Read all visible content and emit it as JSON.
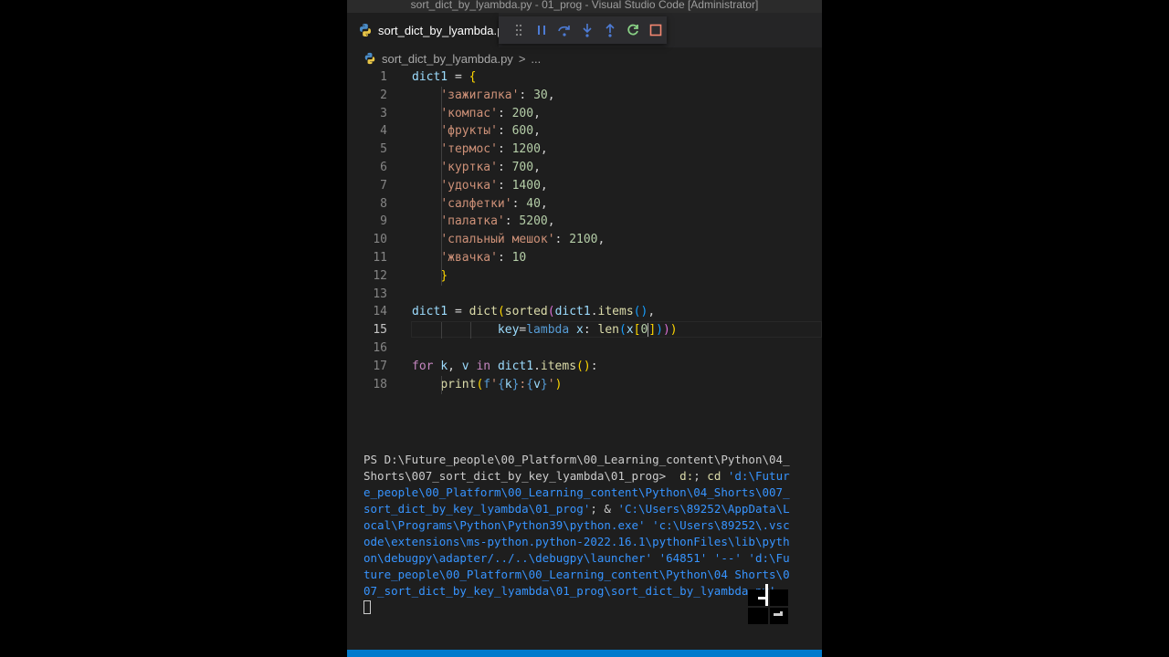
{
  "window": {
    "title": "sort_dict_by_lyambda.py - 01_prog - Visual Studio Code [Administrator]"
  },
  "tab": {
    "label": "sort_dict_by_lyambda.py",
    "icon": "python-icon"
  },
  "debug_toolbar": {
    "buttons": [
      {
        "name": "drag-handle-icon",
        "color": "#8b8b8b"
      },
      {
        "name": "pause-icon",
        "color": "#4d7bd4"
      },
      {
        "name": "step-over-icon",
        "color": "#4d7bd4"
      },
      {
        "name": "step-into-icon",
        "color": "#4d7bd4"
      },
      {
        "name": "step-out-icon",
        "color": "#4d7bd4"
      },
      {
        "name": "restart-icon",
        "color": "#89d185"
      },
      {
        "name": "stop-icon",
        "color": "#f48771"
      }
    ]
  },
  "breadcrumb": {
    "file": "sort_dict_by_lyambda.py",
    "separator": ">",
    "more": "..."
  },
  "editor": {
    "active_line": 15,
    "line_numbers": [
      "1",
      "2",
      "3",
      "4",
      "5",
      "6",
      "7",
      "8",
      "9",
      "10",
      "11",
      "12",
      "13",
      "14",
      "15",
      "16",
      "17",
      "18"
    ],
    "lines": [
      {
        "tokens": [
          [
            "v",
            "dict1"
          ],
          [
            "t",
            " = "
          ],
          [
            "y",
            "{"
          ]
        ]
      },
      {
        "tokens": [
          [
            "t",
            "    "
          ],
          [
            "s",
            "'зажигалка'"
          ],
          [
            "t",
            ": "
          ],
          [
            "n",
            "30"
          ],
          [
            "t",
            ","
          ]
        ]
      },
      {
        "tokens": [
          [
            "t",
            "    "
          ],
          [
            "s",
            "'компас'"
          ],
          [
            "t",
            ": "
          ],
          [
            "n",
            "200"
          ],
          [
            "t",
            ","
          ]
        ]
      },
      {
        "tokens": [
          [
            "t",
            "    "
          ],
          [
            "s",
            "'фрукты'"
          ],
          [
            "t",
            ": "
          ],
          [
            "n",
            "600"
          ],
          [
            "t",
            ","
          ]
        ]
      },
      {
        "tokens": [
          [
            "t",
            "    "
          ],
          [
            "s",
            "'термос'"
          ],
          [
            "t",
            ": "
          ],
          [
            "n",
            "1200"
          ],
          [
            "t",
            ","
          ]
        ]
      },
      {
        "tokens": [
          [
            "t",
            "    "
          ],
          [
            "s",
            "'куртка'"
          ],
          [
            "t",
            ": "
          ],
          [
            "n",
            "700"
          ],
          [
            "t",
            ","
          ]
        ]
      },
      {
        "tokens": [
          [
            "t",
            "    "
          ],
          [
            "s",
            "'удочка'"
          ],
          [
            "t",
            ": "
          ],
          [
            "n",
            "1400"
          ],
          [
            "t",
            ","
          ]
        ]
      },
      {
        "tokens": [
          [
            "t",
            "    "
          ],
          [
            "s",
            "'салфетки'"
          ],
          [
            "t",
            ": "
          ],
          [
            "n",
            "40"
          ],
          [
            "t",
            ","
          ]
        ]
      },
      {
        "tokens": [
          [
            "t",
            "    "
          ],
          [
            "s",
            "'палатка'"
          ],
          [
            "t",
            ": "
          ],
          [
            "n",
            "5200"
          ],
          [
            "t",
            ","
          ]
        ]
      },
      {
        "tokens": [
          [
            "t",
            "    "
          ],
          [
            "s",
            "'спальный мешок'"
          ],
          [
            "t",
            ": "
          ],
          [
            "n",
            "2100"
          ],
          [
            "t",
            ","
          ]
        ]
      },
      {
        "tokens": [
          [
            "t",
            "    "
          ],
          [
            "s",
            "'жвачка'"
          ],
          [
            "t",
            ": "
          ],
          [
            "n",
            "10"
          ]
        ]
      },
      {
        "tokens": [
          [
            "t",
            "    "
          ],
          [
            "y",
            "}"
          ]
        ]
      },
      {
        "tokens": []
      },
      {
        "tokens": [
          [
            "v",
            "dict1"
          ],
          [
            "t",
            " = "
          ],
          [
            "f",
            "dict"
          ],
          [
            "y",
            "("
          ],
          [
            "f",
            "sorted"
          ],
          [
            "p",
            "("
          ],
          [
            "v",
            "dict1"
          ],
          [
            "t",
            "."
          ],
          [
            "f",
            "items"
          ],
          [
            "b",
            "()"
          ],
          [
            "t",
            ","
          ]
        ]
      },
      {
        "tokens": [
          [
            "t",
            "            "
          ],
          [
            "v",
            "key"
          ],
          [
            "t",
            "="
          ],
          [
            "k",
            "lambda"
          ],
          [
            "t",
            " "
          ],
          [
            "v",
            "x"
          ],
          [
            "t",
            ": "
          ],
          [
            "f",
            "len"
          ],
          [
            "b",
            "("
          ],
          [
            "v",
            "x"
          ],
          [
            "y",
            "["
          ],
          [
            "n",
            "0"
          ],
          [
            "cursor",
            ""
          ],
          [
            "y",
            "]"
          ],
          [
            "b",
            ")"
          ],
          [
            "p",
            ")"
          ],
          [
            "y",
            ")"
          ]
        ]
      },
      {
        "tokens": []
      },
      {
        "tokens": [
          [
            "c",
            "for"
          ],
          [
            "t",
            " "
          ],
          [
            "v",
            "k"
          ],
          [
            "t",
            ", "
          ],
          [
            "v",
            "v"
          ],
          [
            "t",
            " "
          ],
          [
            "c",
            "in"
          ],
          [
            "t",
            " "
          ],
          [
            "v",
            "dict1"
          ],
          [
            "t",
            "."
          ],
          [
            "f",
            "items"
          ],
          [
            "y",
            "()"
          ],
          [
            "t",
            ":"
          ]
        ]
      },
      {
        "tokens": [
          [
            "t",
            "    "
          ],
          [
            "f",
            "print"
          ],
          [
            "y",
            "("
          ],
          [
            "k",
            "f"
          ],
          [
            "s",
            "'"
          ],
          [
            "k",
            "{"
          ],
          [
            "v",
            "k"
          ],
          [
            "k",
            "}"
          ],
          [
            "s",
            ":"
          ],
          [
            "k",
            "{"
          ],
          [
            "v",
            "v"
          ],
          [
            "k",
            "}"
          ],
          [
            "s",
            "'"
          ],
          [
            "y",
            ")"
          ]
        ]
      }
    ]
  },
  "terminal": {
    "lines": [
      [
        [
          "tprompt",
          "PS D:\\Future_people\\00_Platform\\00_Learning_content\\Python\\04_"
        ]
      ],
      [
        [
          "tprompt",
          "Shorts\\007_sort_dict_by_key_lyambda\\01_prog> "
        ],
        [
          "tcmd",
          " d:"
        ],
        [
          "tprompt",
          "; "
        ],
        [
          "tcmd",
          "cd"
        ],
        [
          "targ",
          " 'd:\\Futur"
        ]
      ],
      [
        [
          "targ",
          "e_people\\00_Platform\\00_Learning_content\\Python\\04_Shorts\\007_"
        ]
      ],
      [
        [
          "targ",
          "sort_dict_by_key_lyambda\\01_prog'"
        ],
        [
          "tprompt",
          "; & "
        ],
        [
          "targ",
          "'C:\\Users\\89252\\AppData\\L"
        ]
      ],
      [
        [
          "targ",
          "ocal\\Programs\\Python\\Python39\\python.exe' 'c:\\Users\\89252\\.vsc"
        ]
      ],
      [
        [
          "targ",
          "ode\\extensions\\ms-python.python-2022.16.1\\pythonFiles\\lib\\pyth"
        ]
      ],
      [
        [
          "targ",
          "on\\debugpy\\adapter/../..\\debugpy\\launcher' '64851' '--' 'd:\\Fu"
        ]
      ],
      [
        [
          "targ",
          "ture_people\\00_Platform\\00_Learning_content\\Python\\04 Shorts\\0"
        ]
      ],
      [
        [
          "targ",
          "07_sort_dict_by_key_lyambda\\01_prog\\sort_dict_by_lyambda.py'"
        ]
      ]
    ]
  },
  "colors": {
    "editor_bg": "#1e1e1e",
    "statusbar": "#007acc"
  }
}
